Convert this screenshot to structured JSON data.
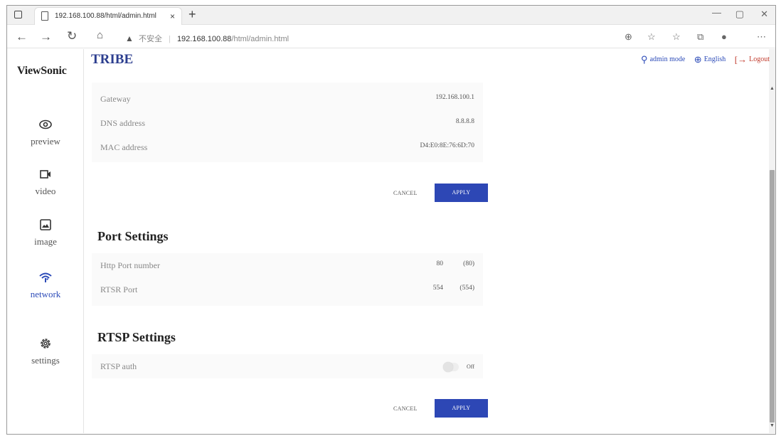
{
  "browser": {
    "tab_title": "192.168.100.88/html/admin.html",
    "tab_close": "×",
    "new_tab": "+",
    "warning_icon": "▲",
    "insecure_label": "不安全",
    "url_host": "192.168.100.88",
    "url_path": "/html/admin.html"
  },
  "app": {
    "brand": "ViewSonic",
    "title": "TRIBE",
    "header": {
      "admin_mode": "admin mode",
      "language": "English",
      "logout": "Logout"
    }
  },
  "sidebar": {
    "items": [
      {
        "label": "preview",
        "icon": "eye-icon"
      },
      {
        "label": "video",
        "icon": "video-camera-icon"
      },
      {
        "label": "image",
        "icon": "image-icon"
      },
      {
        "label": "network",
        "icon": "wifi-icon"
      },
      {
        "label": "settings",
        "icon": "gear-icon"
      }
    ],
    "active": "network"
  },
  "network": {
    "rows": [
      {
        "label": "Gateway",
        "value": "192.168.100.1"
      },
      {
        "label": "DNS address",
        "value": "8.8.8.8"
      },
      {
        "label": "MAC address",
        "value": "D4:E0:8E:76:6D:70"
      }
    ],
    "cancel_label": "CANCEL",
    "apply_label": "APPLY"
  },
  "port_settings": {
    "title": "Port Settings",
    "rows": [
      {
        "label": "Http Port number",
        "value": "80",
        "default": "(80)"
      },
      {
        "label": "RTSR Port",
        "value": "554",
        "default": "(554)"
      }
    ]
  },
  "rtsp_settings": {
    "title": "RTSP Settings",
    "auth_label": "RTSP auth",
    "auth_state": "Off",
    "cancel_label": "CANCEL",
    "apply_label": "APPLY"
  },
  "colors": {
    "accent": "#2d47b5",
    "title": "#2c3e8f",
    "logout": "#c0392b"
  }
}
